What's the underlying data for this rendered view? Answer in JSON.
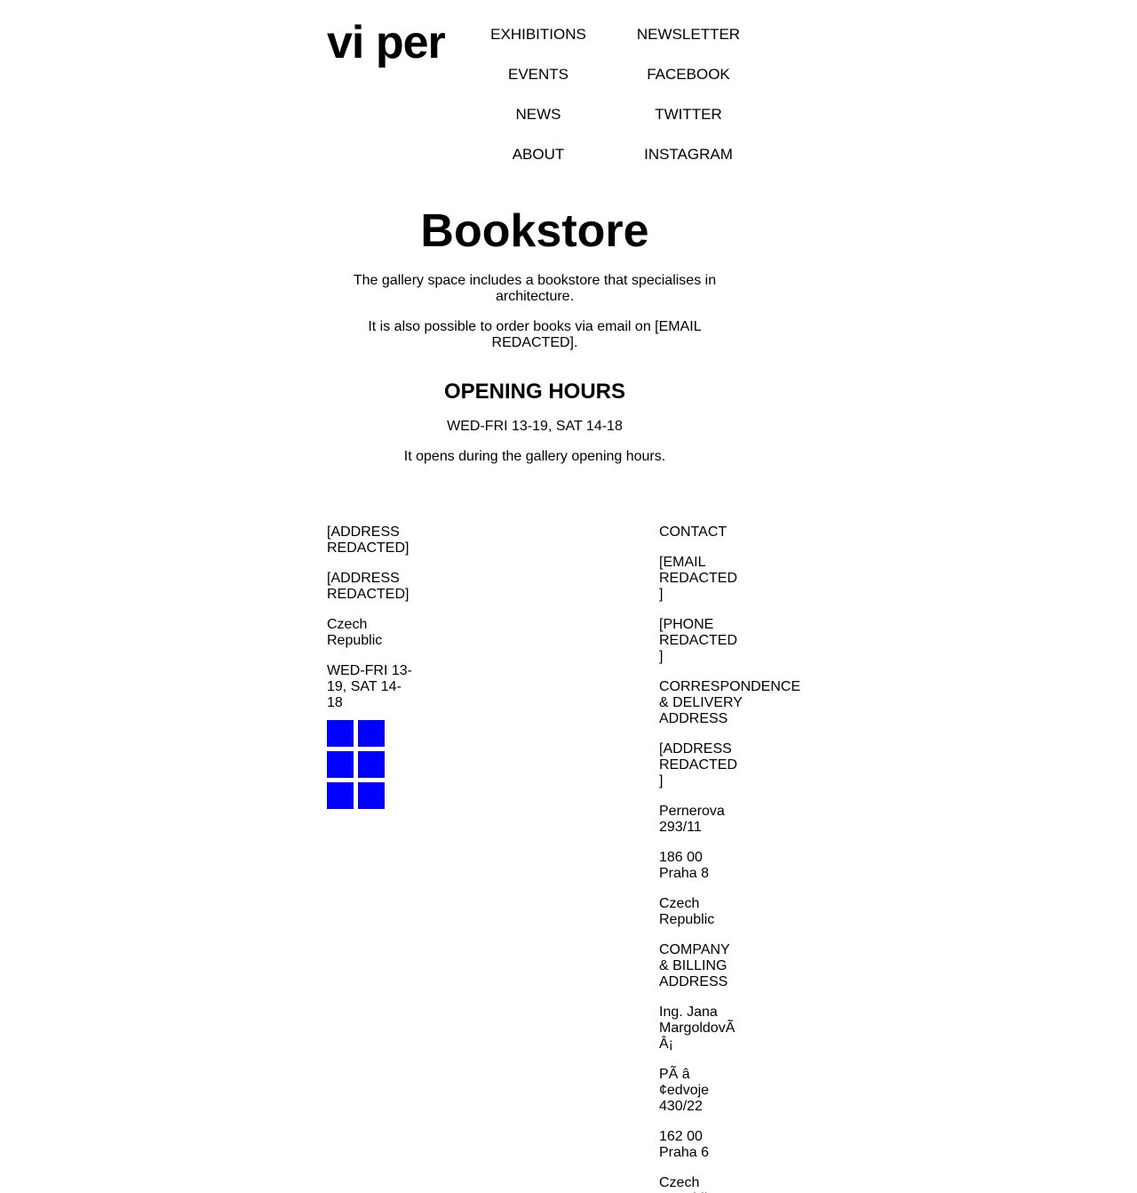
{
  "header": {
    "logo": "vi per",
    "nav_left": [
      "EXHIBITIONS",
      "EVENTS",
      "NEWS",
      "ABOUT"
    ],
    "nav_right": [
      "NEWSLETTER",
      "FACEBOOK",
      "TWITTER",
      "INSTAGRAM"
    ]
  },
  "main": {
    "title": "Bookstore",
    "intro": "The gallery space includes a bookstore that specialises in architecture.",
    "order_text": "It is also possible to order books via email on [EMAIL REDACTED].",
    "hours_heading": "OPENING HOURS",
    "hours": "WED-FRI 13-19, SAT 14-18",
    "hours_note": "It opens during the gallery opening hours."
  },
  "footer": {
    "left": {
      "address_1": "[ADDRESS REDACTED]",
      "address_2": "[ADDRESS REDACTED]",
      "country": "Czech Republic",
      "hours": "WED-FRI 13-19, SAT 14-18",
      "tile_color": "#0000ff",
      "tiles": 6
    },
    "right": {
      "contact_heading": "CONTACT",
      "email": "[EMAIL REDACTED]",
      "phone": "[PHONE REDACTED]",
      "correspondence_heading": "CORRESPONDENCE & DELIVERY ADDRESS",
      "correspondence_address": "[ADDRESS REDACTED]",
      "street": "Pernerova 293/11",
      "postal_city": "186 00 Praha 8",
      "country": "Czech Republic",
      "company_heading": "COMPANY & BILLING ADDRESS",
      "company_name": "Ing. Jana MargoldovÃ Â¡",
      "company_street": "PÃ â ¢edvoje 430/22",
      "company_postal_city": "162 00 Praha 6",
      "company_country": "Czech Republic"
    }
  }
}
